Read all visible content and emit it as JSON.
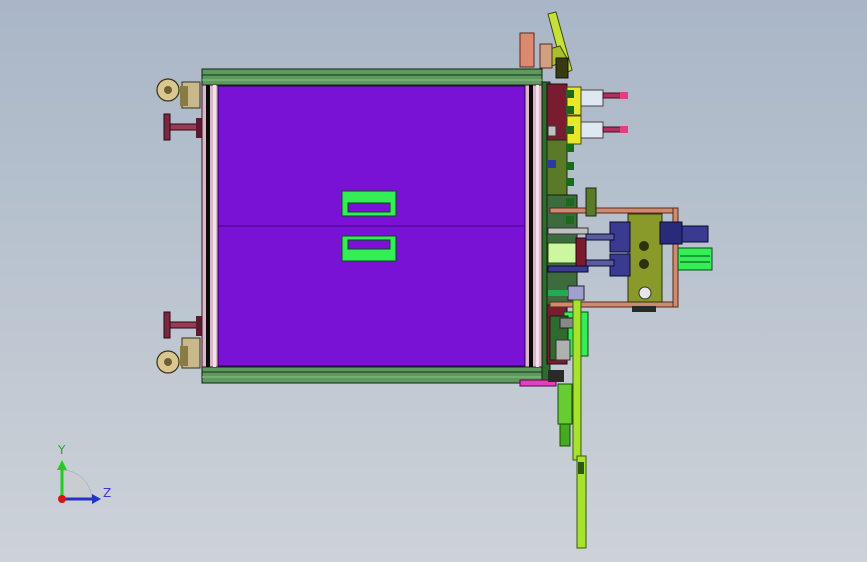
{
  "view": {
    "background_top": "#a9b6c7",
    "background_bottom": "#cdd2d8"
  },
  "model": {
    "panel_color": "#7a12d6",
    "frame_color": "#4f8a4f",
    "handle_color": "#33ee55",
    "accent_yellow": "#e8e82a",
    "accent_red": "#8a1020",
    "rail_color": "#a6e22e"
  },
  "triad": {
    "y_label": "Y",
    "z_label": "Z",
    "y_color": "#22cc22",
    "z_color": "#2233cc",
    "origin_color": "#dd1111"
  }
}
